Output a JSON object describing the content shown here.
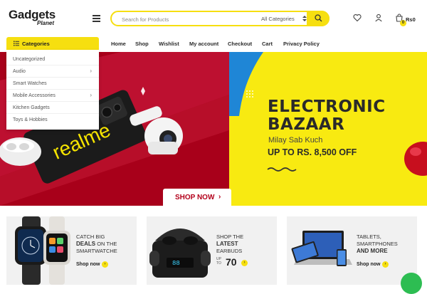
{
  "logo": {
    "main": "Gadgets",
    "sub": "Planet"
  },
  "search": {
    "placeholder": "Search for Products",
    "category": "All Categories"
  },
  "cart": {
    "count": "0",
    "total": "Rs0"
  },
  "categories_button": "Categories",
  "nav": [
    "Home",
    "Shop",
    "Wishlist",
    "My account",
    "Checkout",
    "Cart",
    "Privacy Policy"
  ],
  "category_menu": [
    {
      "label": "Uncategorized",
      "has_sub": false
    },
    {
      "label": "Audio",
      "has_sub": true
    },
    {
      "label": "Smart Watches",
      "has_sub": false
    },
    {
      "label": "Mobile Accessories",
      "has_sub": true
    },
    {
      "label": "Kitchen Gadgets",
      "has_sub": false
    },
    {
      "label": "Toys & Hobbies",
      "has_sub": false
    }
  ],
  "hero": {
    "title_line1": "ELECTRONIC",
    "title_line2": "BAZAAR",
    "tagline": "Milay Sab Kuch",
    "offer": "UP TO RS. 8,500 OFF",
    "shop_now": "SHOP NOW",
    "banner_brand": "realme"
  },
  "cards": [
    {
      "line1": "CATCH BIG",
      "highlight": "DEALS",
      "line2_rest": " ON THE",
      "line3": "SMARTWATCHE",
      "shop": "Shop now"
    },
    {
      "line1": "SHOP THE",
      "highlight": "LATEST",
      "line3": "EARBUDS",
      "price_prefix": "UP TO",
      "price": "70"
    },
    {
      "line1": "TABLETS,",
      "line2": "SMARTPHONES",
      "highlight": "AND MORE",
      "shop": "Shop now"
    }
  ],
  "colors": {
    "accent": "#f6df10",
    "hero_red": "#a8001a",
    "hero_yellow": "#f8ea11"
  }
}
